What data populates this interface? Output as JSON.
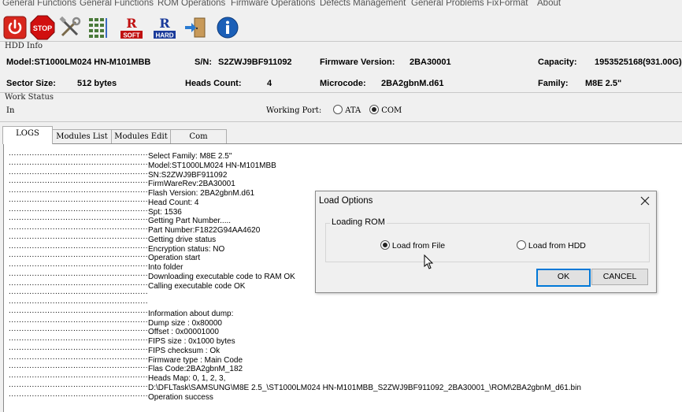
{
  "menu": {
    "items": [
      "General Functions",
      "General Functions",
      "ROM Operations",
      "Firmware Operations",
      "Defects Management",
      "General Problems Fix",
      "Format",
      "About"
    ]
  },
  "toolbar": {
    "icons": [
      "power-icon",
      "stop-icon",
      "tools-icon",
      "modules-icon",
      "read-soft-icon",
      "read-hard-icon",
      "exit-icon",
      "info-icon"
    ],
    "stop_text": "STOP",
    "soft_text": "SOFT",
    "hard_text": "HARD"
  },
  "hdd_info": {
    "title": "HDD Info",
    "model_label": "Model:ST1000LM024 HN-M101MBB",
    "sn_label": "S/N:",
    "sn_value": "S2ZWJ9BF911092",
    "fw_label": "Firmware Version:",
    "fw_value": "2BA30001",
    "capacity_label": "Capacity:",
    "capacity_value": "1953525168(931.00G)",
    "sector_label": "Sector Size:",
    "sector_value": "512 bytes",
    "heads_label": "Heads Count:",
    "heads_value": "4",
    "microcode_label": "Microcode:",
    "microcode_value": "2BA2gbnM.d61",
    "family_label": "Family:",
    "family_value": "M8E 2.5\""
  },
  "work_status": {
    "title": "Work Status",
    "status": "In",
    "port_label": "Working Port:",
    "ports": [
      {
        "label": "ATA",
        "selected": false
      },
      {
        "label": "COM",
        "selected": true
      }
    ]
  },
  "tabs": [
    "LOGS",
    "Modules List",
    "Modules Edit",
    "Com"
  ],
  "log": {
    "dots": "...............................................................",
    "lines": [
      "Select Family: M8E 2.5\"",
      "Model:ST1000LM024 HN-M101MBB",
      "SN:S2ZWJ9BF911092",
      "FirmWareRev:2BA30001",
      "Flash Version: 2BA2gbnM.d61",
      "Head Count: 4",
      "Spt: 1536",
      "Getting Part Number.....",
      "Part Number:F1822G94AA4620",
      "Getting drive status",
      "Encryption status: NO",
      "Operation start",
      "Into folder",
      "Downloading executable code to RAM OK",
      "Calling executable code OK",
      "",
      "",
      "Information about dump:",
      "Dump size : 0x80000",
      "Offset : 0x00001000",
      "FIPS size : 0x1000 bytes",
      "FIPS checksum  : Ok",
      "Firmware type : Main Code",
      "Flas Code:2BA2gbnM_182",
      "Heads Map: 0, 1, 2, 3,",
      "D:\\DFLTask\\SAMSUNG\\M8E 2.5_\\ST1000LM024 HN-M101MBB_S2ZWJ9BF911092_2BA30001_\\ROM\\2BA2gbnM_d61.bin",
      "Operation success"
    ]
  },
  "dialog": {
    "title": "Load Options",
    "group_label": "Loading ROM",
    "option_file": "Load from File",
    "option_hdd": "Load from HDD",
    "selected": "file",
    "ok_label": "OK",
    "cancel_label": "CANCEL"
  },
  "colors": {
    "power_red": "#d8261c",
    "stop_red": "#d10f0f",
    "info_blue": "#1b5fb7",
    "focus_blue": "#0078d7"
  }
}
